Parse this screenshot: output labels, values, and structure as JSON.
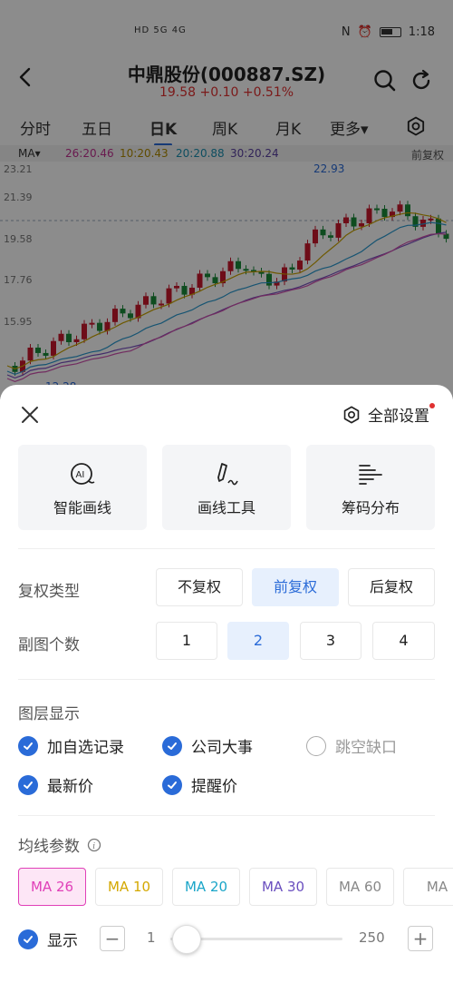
{
  "status": {
    "time": "1:18",
    "left_icons": "HD 5G 4G"
  },
  "header": {
    "title": "中鼎股份(000887.SZ)",
    "quote": "19.58 +0.10 +0.51%"
  },
  "tabs": [
    {
      "label": "分时"
    },
    {
      "label": "五日"
    },
    {
      "label": "日K"
    },
    {
      "label": "周K"
    },
    {
      "label": "月K"
    },
    {
      "label": "更多▾"
    }
  ],
  "ma_bar": {
    "label": "MA▾",
    "ma26": "26:20.46",
    "ma10": "10:20.43",
    "ma20": "20:20.88",
    "ma30": "30:20.24",
    "adjust": "前复权"
  },
  "chart_data": {
    "type": "candlestick",
    "y_ticks": [
      "23.21",
      "21.39",
      "19.58",
      "17.76",
      "15.95"
    ],
    "high_label": "22.93",
    "low_label_partial": "12.28"
  },
  "sheet": {
    "all_settings": "全部设置",
    "tools": [
      {
        "label": "智能画线",
        "icon": "ai-line-icon"
      },
      {
        "label": "画线工具",
        "icon": "pen-icon"
      },
      {
        "label": "筹码分布",
        "icon": "chip-distribution-icon"
      }
    ],
    "adjust_type": {
      "label": "复权类型",
      "options": [
        "不复权",
        "前复权",
        "后复权"
      ],
      "selected": "前复权"
    },
    "sub_chart": {
      "label": "副图个数",
      "options": [
        "1",
        "2",
        "3",
        "4"
      ],
      "selected": "2"
    },
    "layers": {
      "label": "图层显示",
      "items": [
        {
          "label": "加自选记录",
          "checked": true
        },
        {
          "label": "公司大事",
          "checked": true
        },
        {
          "label": "跳空缺口",
          "checked": false
        },
        {
          "label": "最新价",
          "checked": true
        },
        {
          "label": "提醒价",
          "checked": true
        }
      ]
    },
    "ma_params": {
      "label": "均线参数",
      "tabs": [
        {
          "label": "MA 26",
          "color": "#e040b8"
        },
        {
          "label": "MA 10",
          "color": "#d4a800"
        },
        {
          "label": "MA 20",
          "color": "#1aa5c8"
        },
        {
          "label": "MA 30",
          "color": "#6a4fbf"
        },
        {
          "label": "MA 60",
          "color": "#888888"
        },
        {
          "label": "MA",
          "color": "#888888"
        }
      ],
      "show_label": "显示",
      "min": "1",
      "max": "250"
    }
  },
  "colors": {
    "accent": "#2a6bd8",
    "up": "#c8182c",
    "down": "#1a8a3a"
  }
}
